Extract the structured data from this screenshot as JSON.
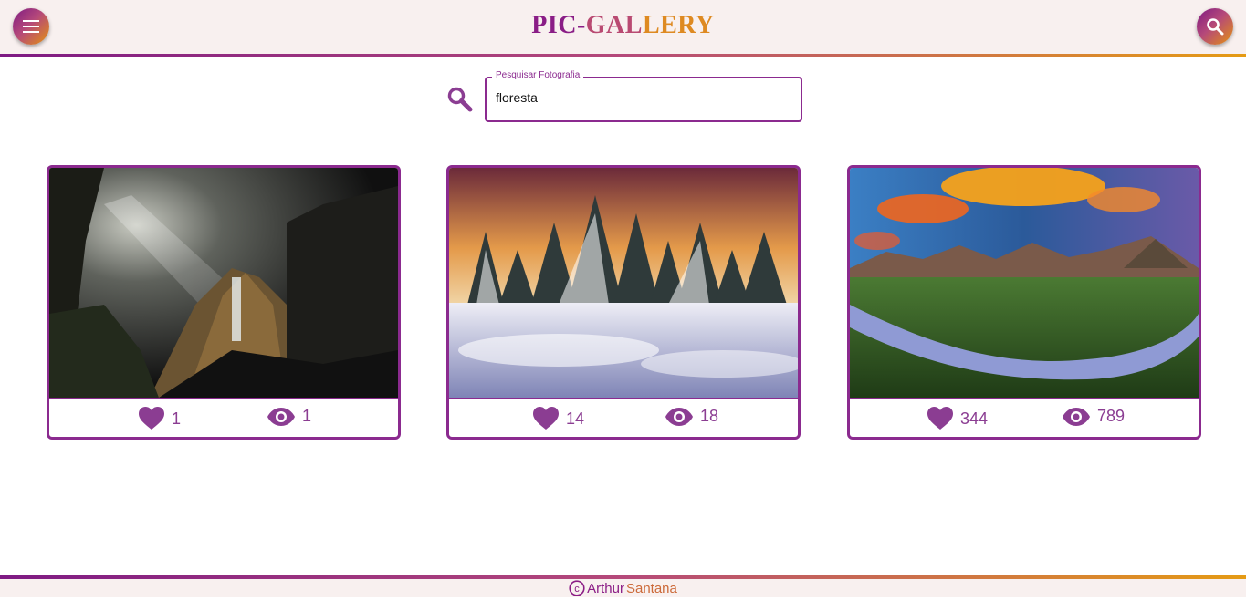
{
  "header": {
    "brand_part1": "PIC-",
    "brand_part2": "GAL",
    "brand_part3": "LERY",
    "menu_icon": "menu-icon",
    "search_icon": "search-icon"
  },
  "search": {
    "label": "Pesquisar Fotografia",
    "value": "floresta"
  },
  "cards": [
    {
      "likes": "1",
      "views": "1",
      "image": "dark-fantasy-waterfall-landscape"
    },
    {
      "likes": "14",
      "views": "18",
      "image": "snowy-pine-forest-sunset"
    },
    {
      "likes": "344",
      "views": "789",
      "image": "river-valley-mountains-sunset"
    }
  ],
  "footer": {
    "name_first": "Arthur",
    "name_last": "Santana",
    "copyright_icon": "copyright-icon"
  },
  "colors": {
    "primary": "#8b2a8f",
    "accent": "#e59b14",
    "header_bg": "#f8f0ef"
  }
}
